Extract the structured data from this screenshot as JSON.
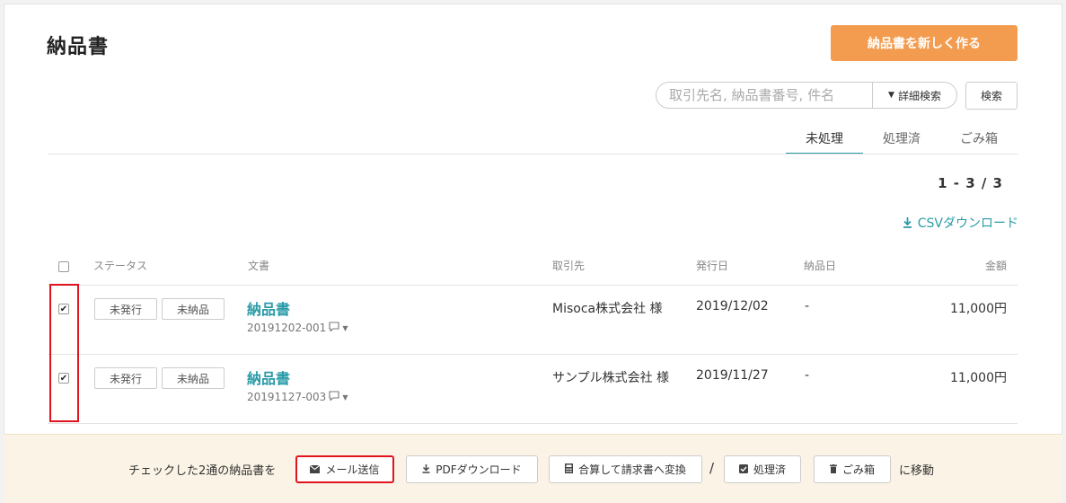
{
  "header": {
    "title": "納品書",
    "new_button": "納品書を新しく作る"
  },
  "search": {
    "placeholder": "取引先名, 納品書番号, 件名",
    "advanced_label": "詳細検索",
    "submit_label": "検索"
  },
  "tabs": [
    {
      "label": "未処理",
      "active": true
    },
    {
      "label": "処理済",
      "active": false
    },
    {
      "label": "ごみ箱",
      "active": false
    }
  ],
  "pagination": {
    "text": "1 - 3 / 3"
  },
  "csv_download": "CSVダウンロード",
  "table": {
    "headers": {
      "status": "ステータス",
      "document": "文書",
      "client": "取引先",
      "issue_date": "発行日",
      "delivery_date": "納品日",
      "amount": "金額"
    },
    "rows": [
      {
        "checked": true,
        "status1": "未発行",
        "status2": "未納品",
        "doc_title": "納品書",
        "doc_number": "20191202-001",
        "client": "Misoca株式会社 様",
        "issue_date": "2019/12/02",
        "delivery_date": "-",
        "amount": "11,000円"
      },
      {
        "checked": true,
        "status1": "未発行",
        "status2": "未納品",
        "doc_title": "納品書",
        "doc_number": "20191127-003",
        "client": "サンプル株式会社 様",
        "issue_date": "2019/11/27",
        "delivery_date": "-",
        "amount": "11,000円"
      }
    ]
  },
  "bulk": {
    "prefix": "チェックした2通の納品書を",
    "email": "メール送信",
    "pdf": "PDFダウンロード",
    "merge": "合算して請求書へ変換",
    "separator": "/",
    "processed": "処理済",
    "trash": "ごみ箱",
    "suffix": "に移動"
  },
  "colors": {
    "accent": "#2a9ba8",
    "primary_button": "#f39c4f",
    "highlight": "#e0141e"
  },
  "icons": {
    "download": "download-icon",
    "comment": "comment-icon",
    "mail": "mail-icon",
    "calculator": "calculator-icon",
    "check": "check-square-icon",
    "trash": "trash-icon"
  }
}
